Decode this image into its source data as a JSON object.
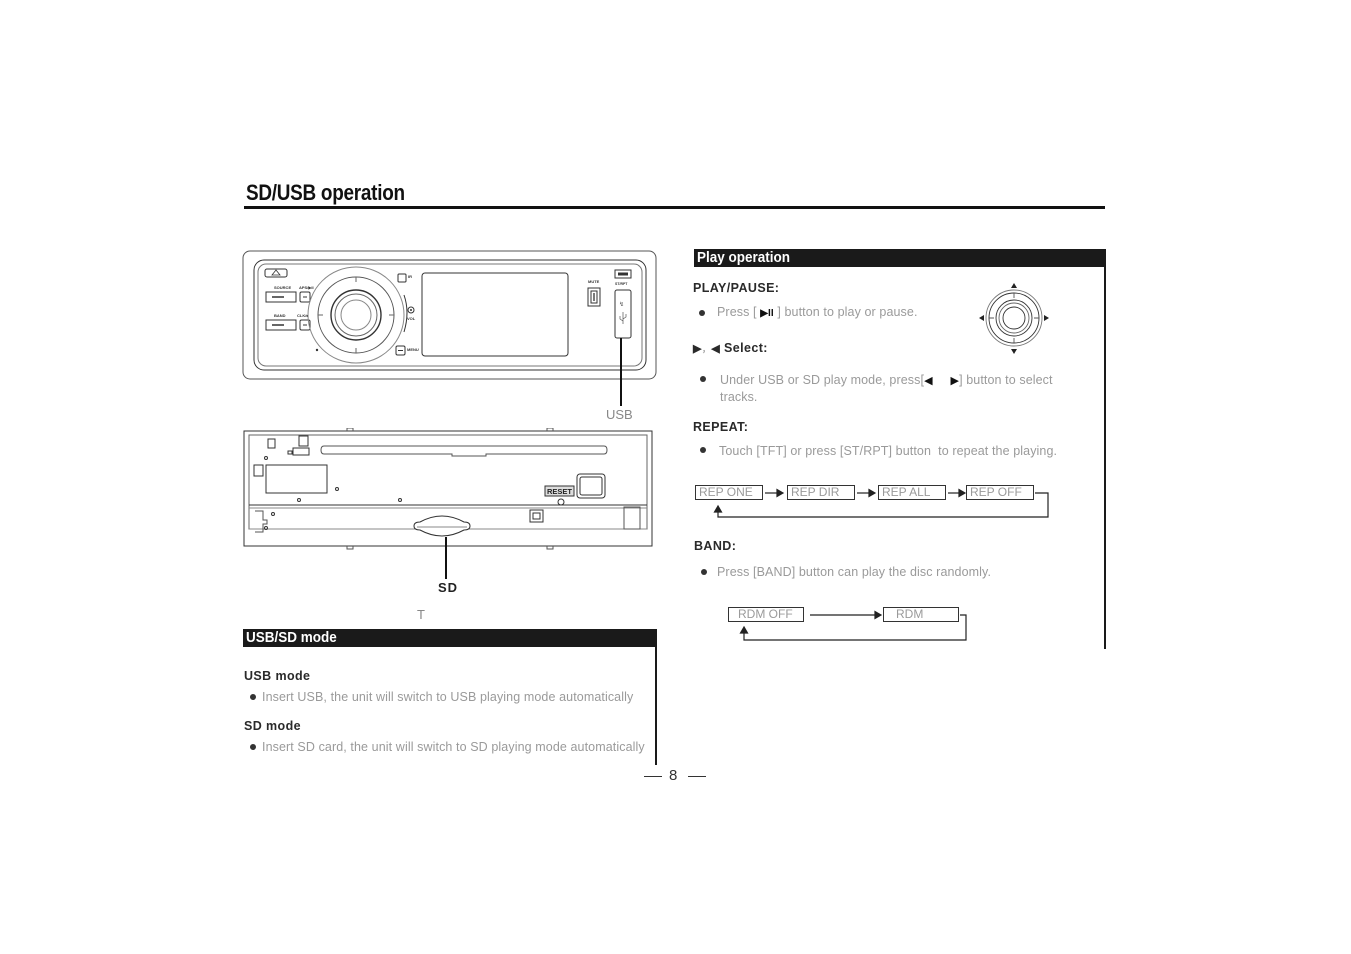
{
  "page": {
    "title": "SD/USB operation",
    "page_number": "8"
  },
  "figures": {
    "usb_label": "USB",
    "sd_label": "SD",
    "stray_char": "T",
    "front_panel": {
      "buttons": [
        "SOURCE",
        "APS/▶II",
        "BAND",
        "CLK/■",
        "IR",
        "VOL",
        "MENU",
        "MUTE",
        "ST/RPT"
      ]
    },
    "back_panel": {
      "reset_label": "RESET"
    }
  },
  "usb_sd_mode": {
    "heading": "USB/SD mode",
    "usb": {
      "title": "USB mode",
      "text": "Insert USB, the unit will switch to USB playing mode automatically"
    },
    "sd": {
      "title": "SD mode",
      "text": "Insert SD card, the unit will switch to SD playing mode automatically"
    }
  },
  "play_operation": {
    "heading": "Play operation",
    "play_pause": {
      "title": "PLAY/PAUSE:",
      "text_pre": "Press [",
      "icon": "▶II",
      "text_post": "] button to play or pause."
    },
    "select": {
      "icon_next": "▶",
      "separator": "，",
      "icon_prev": "◀",
      "title": "Select:",
      "text_pre": "Under USB or SD play mode, press[",
      "icon_a": "◀",
      "icon_b": "▶",
      "text_post": "] button to select",
      "text_line2": "tracks."
    },
    "repeat": {
      "title": "REPEAT:",
      "text": "Touch [TFT] or press [ST/RPT] button  to repeat the playing.",
      "flow": [
        "REP ONE",
        "REP DIR",
        "REP ALL",
        "REP  OFF"
      ]
    },
    "band": {
      "title": "BAND:",
      "text": "Press [BAND] button can play the disc randomly.",
      "flow": [
        "RDM  OFF",
        "RDM"
      ]
    }
  }
}
